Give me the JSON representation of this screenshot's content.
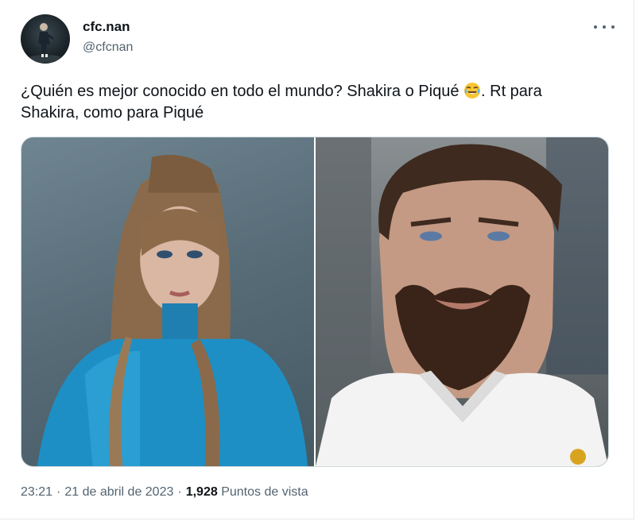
{
  "author": {
    "display_name": "cfc.nan",
    "handle": "@cfcnan",
    "avatar_icon": "profile-avatar"
  },
  "tweet": {
    "text_before_emoji": "¿Quién es mejor conocido en todo el mundo? Shakira o Piqué ",
    "emoji": "face-with-tears-of-joy-icon",
    "text_after_emoji": ". Rt para Shakira, como para Piqué"
  },
  "media": {
    "left_photo": "woman-with-long-ponytail-blue-outfit",
    "right_photo": "bearded-man-white-jersey"
  },
  "meta": {
    "time": "23:21",
    "separator": "·",
    "date": "21 de abril de 2023",
    "separator2": "·",
    "views_count": "1,928",
    "views_label": "Puntos de vista"
  },
  "colors": {
    "text_primary": "#0f1419",
    "text_secondary": "#536471",
    "border": "#cfd9de"
  }
}
